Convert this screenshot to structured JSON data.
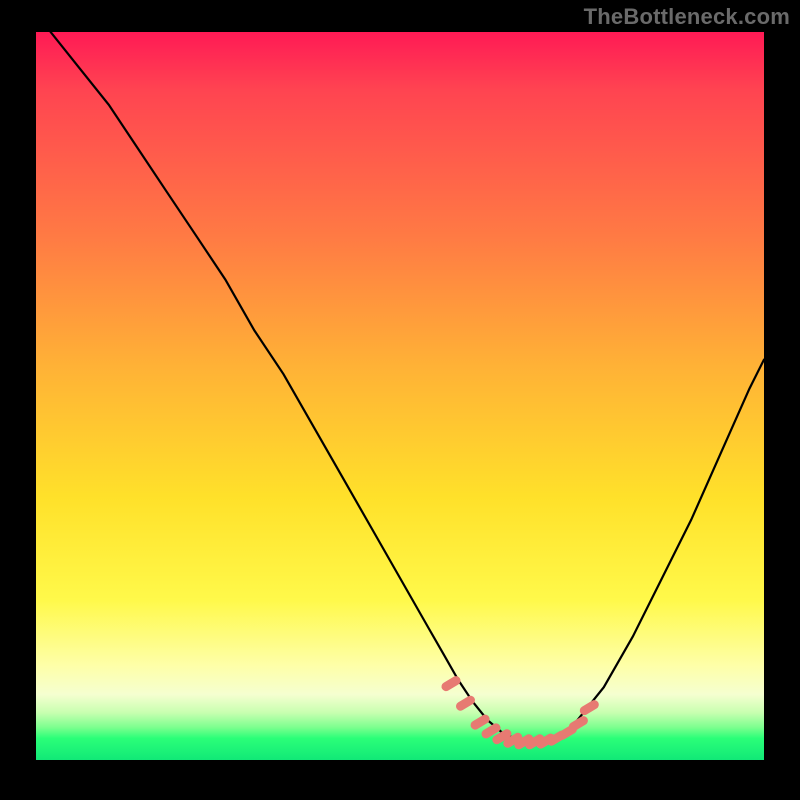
{
  "watermark": "TheBottleneck.com",
  "colors": {
    "marker": "#e77a72",
    "curve": "#000000"
  },
  "chart_data": {
    "type": "line",
    "title": "",
    "xlabel": "",
    "ylabel": "",
    "xlim": [
      0,
      100
    ],
    "ylim": [
      0,
      100
    ],
    "grid": false,
    "series": [
      {
        "name": "bottleneck-curve",
        "x": [
          2,
          6,
          10,
          14,
          18,
          22,
          26,
          30,
          34,
          38,
          42,
          46,
          50,
          54,
          56,
          58,
          60,
          62,
          64,
          66,
          68,
          70,
          72,
          74,
          78,
          82,
          86,
          90,
          94,
          98,
          100
        ],
        "y": [
          100,
          95,
          90,
          84,
          78,
          72,
          66,
          59,
          53,
          46,
          39,
          32,
          25,
          18,
          14.5,
          11,
          8,
          5.5,
          3.8,
          2.8,
          2.5,
          2.7,
          3.5,
          5,
          10,
          17,
          25,
          33,
          42,
          51,
          55
        ]
      }
    ],
    "markers": {
      "name": "valley-markers",
      "x": [
        57,
        59,
        61,
        62.5,
        64,
        65.5,
        67,
        68.5,
        70,
        71.5,
        73,
        74.5,
        76
      ],
      "y": [
        10.5,
        7.8,
        5.2,
        4.0,
        3.2,
        2.7,
        2.5,
        2.5,
        2.6,
        3.0,
        3.8,
        5.0,
        7.2
      ],
      "style": "rounded-cap"
    },
    "gradient_stops_pct": [
      0,
      8,
      28,
      46,
      64,
      78,
      87,
      91,
      93.5,
      95.5,
      97,
      100
    ],
    "gradient_colors": [
      "#ff1a55",
      "#ff4451",
      "#ff7a44",
      "#ffb236",
      "#ffe12a",
      "#fff94a",
      "#feffa8",
      "#f5ffd0",
      "#c8ffb0",
      "#7dff8f",
      "#2bff78",
      "#11e877"
    ]
  }
}
